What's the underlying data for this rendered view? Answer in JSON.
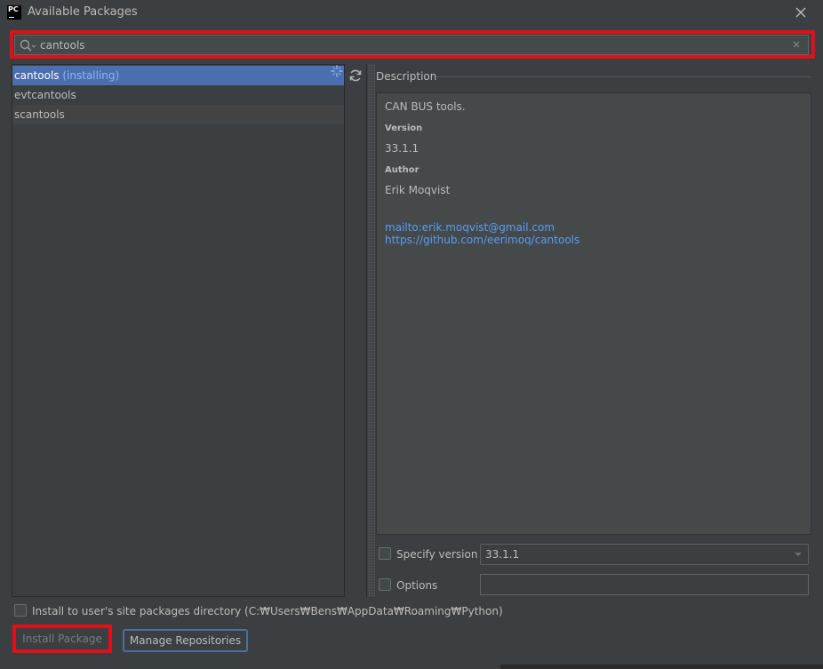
{
  "window": {
    "title": "Available Packages",
    "app_icon_text": "PC"
  },
  "search": {
    "value": "cantools",
    "placeholder": ""
  },
  "packages": [
    {
      "name": "cantools",
      "status": "(installing)"
    },
    {
      "name": "evtcantools",
      "status": ""
    },
    {
      "name": "scantools",
      "status": ""
    }
  ],
  "description": {
    "label": "Description",
    "summary": "CAN BUS tools.",
    "version_heading": "Version",
    "version": "33.1.1",
    "author_heading": "Author",
    "author": "Erik Moqvist",
    "email_link": "mailto:erik.moqvist@gmail.com",
    "homepage_link": "https://github.com/eerimoq/cantools"
  },
  "options": {
    "specify_version_label": "Specify version",
    "specify_version_value": "33.1.1",
    "options_label": "Options",
    "options_value": ""
  },
  "footer": {
    "user_site_label": "Install to user's site packages directory (C:₩Users₩Bens₩AppData₩Roaming₩Python)",
    "install_button": "Install Package",
    "manage_button": "Manage Repositories"
  },
  "colors": {
    "background": "#3c3f41",
    "selection": "#4b6eaf",
    "link": "#589df6",
    "highlight_border": "#e0101a"
  }
}
